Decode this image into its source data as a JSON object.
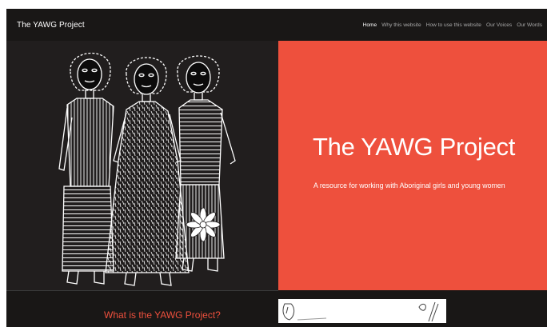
{
  "site": {
    "brand": "The YAWG Project"
  },
  "nav": {
    "items": [
      {
        "label": "Home",
        "active": true
      },
      {
        "label": "Why this website",
        "active": false
      },
      {
        "label": "How to use this website",
        "active": false
      },
      {
        "label": "Our Voices",
        "active": false
      },
      {
        "label": "Our Words",
        "active": false
      }
    ]
  },
  "hero": {
    "title": "The YAWG Project",
    "subtitle": "A resource for working with Aboriginal girls and young women",
    "panel_color": "#ee503d"
  },
  "section": {
    "title": "What is the YAWG Project?"
  },
  "colors": {
    "accent": "#ee503d",
    "background": "#191716",
    "text": "#ffffff"
  }
}
